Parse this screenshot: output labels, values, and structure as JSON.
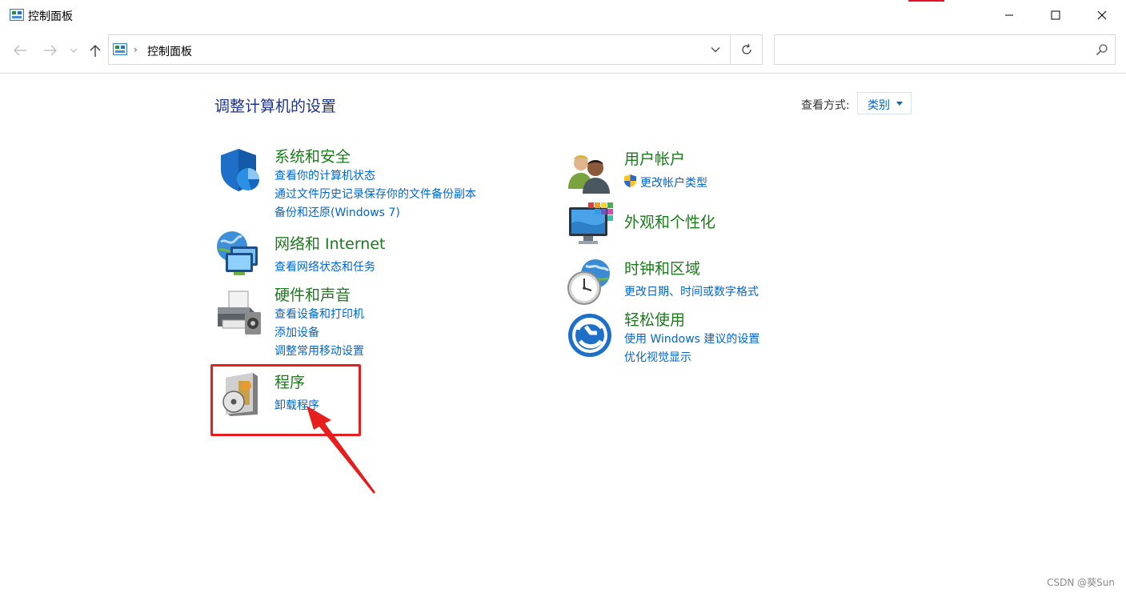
{
  "window": {
    "title": "控制面板"
  },
  "address_bar": {
    "path": "控制面板",
    "separator": "›"
  },
  "search": {
    "placeholder": ""
  },
  "content": {
    "heading": "调整计算机的设置",
    "view_by_label": "查看方式:",
    "view_by_value": "类别"
  },
  "categories_left": [
    {
      "title": "系统和安全",
      "icon": "shield-icon",
      "links": [
        "查看你的计算机状态",
        "通过文件历史记录保存你的文件备份副本",
        "备份和还原(Windows 7)"
      ]
    },
    {
      "title": "网络和 Internet",
      "icon": "network-icon",
      "links": [
        "查看网络状态和任务"
      ]
    },
    {
      "title": "硬件和声音",
      "icon": "printer-icon",
      "links": [
        "查看设备和打印机",
        "添加设备",
        "调整常用移动设置"
      ]
    },
    {
      "title": "程序",
      "icon": "programs-icon",
      "links": [
        "卸载程序"
      ]
    }
  ],
  "categories_right": [
    {
      "title": "用户帐户",
      "icon": "users-icon",
      "links": [
        "更改帐户类型"
      ]
    },
    {
      "title": "外观和个性化",
      "icon": "personalization-icon",
      "links": []
    },
    {
      "title": "时钟和区域",
      "icon": "clock-globe-icon",
      "links": [
        "更改日期、时间或数字格式"
      ]
    },
    {
      "title": "轻松使用",
      "icon": "ease-of-access-icon",
      "links": [
        "使用 Windows 建议的设置",
        "优化视觉显示"
      ]
    }
  ],
  "watermark": "CSDN @葵Sun",
  "colors": {
    "category_title": "#1b7a1b",
    "link": "#0066cc",
    "heading": "#1e3287",
    "annotation": "#e61e1e"
  }
}
